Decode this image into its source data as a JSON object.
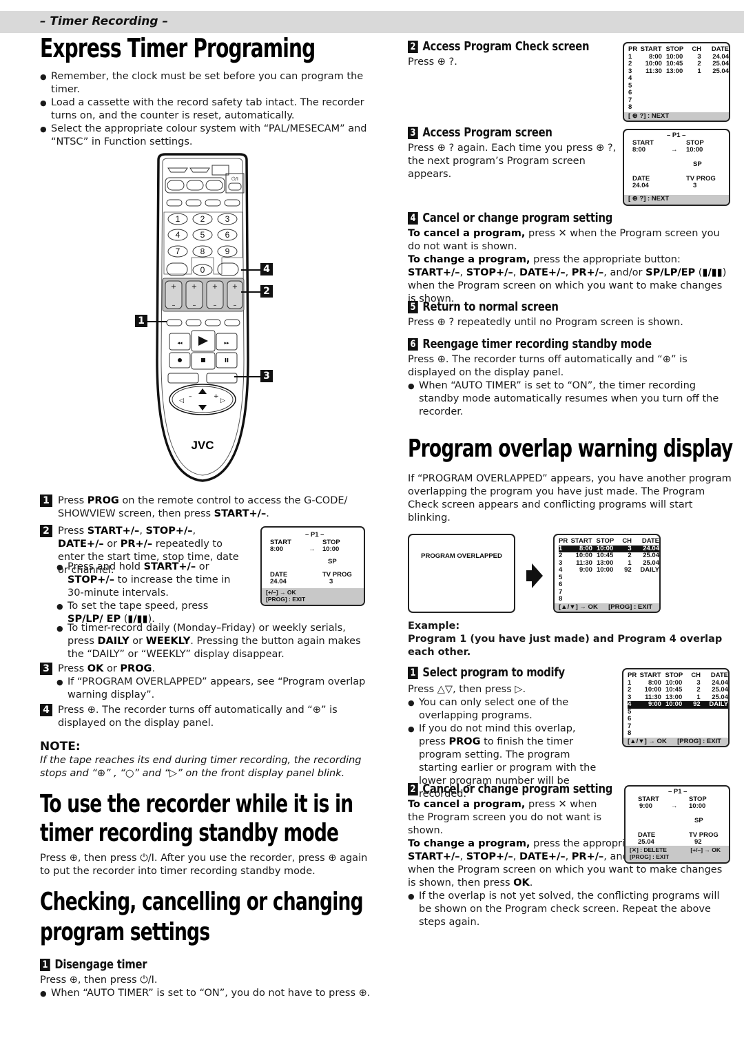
{
  "header": {
    "section_tag": "– Timer Recording –"
  },
  "express": {
    "title": "Express Timer Programing",
    "bullets": [
      "Remember, the clock must be set before you can program the timer.",
      "Load a cassette with the record safety tab intact. The recorder turns on, and the counter is reset, automatically.",
      "Select the appropriate colour system with “PAL/MESECAM” and “NTSC” in Function settings."
    ],
    "remote": {
      "brand": "JVC",
      "keys": [
        "1",
        "2",
        "3",
        "4",
        "5",
        "6",
        "7",
        "8",
        "9",
        "0"
      ],
      "callouts": [
        "1",
        "2",
        "3",
        "4"
      ]
    },
    "steps": [
      {
        "num": "1",
        "text_html": "Press <b>PROG</b> on the remote control to access the G-CODE/ SHOWVIEW screen, then press <b>START+/–</b>."
      },
      {
        "num": "2",
        "text_html": "Press <b>START+/–</b>, <b>STOP+/–</b>, <b>DATE+/–</b> or <b>PR+/–</b> repeatedly to enter the start time, stop time, date or channel."
      },
      {
        "num": "3",
        "text_html": "Press <b>OK</b> or <b>PROG</b>."
      },
      {
        "num": "4",
        "text_html": "Press ⊕. The recorder turns off automatically and “⊕” is displayed on the display panel."
      }
    ],
    "step2_bullets": [
      "Press and hold <b>START+/–</b> or <b>STOP+/–</b> to increase the time in 30-minute intervals.",
      "To set the tape speed, press <b>SP/LP/ EP</b> (<b>▮/▮▮</b>).",
      "To timer-record daily (Monday–Friday) or weekly serials, press <b>DAILY</b> or <b>WEEKLY</b>. Pressing the button again makes the “DAILY” or “WEEKLY” display disappear."
    ],
    "step3_bullets": [
      "If “PROGRAM OVERLAPPED” appears, see “Program overlap warning display”."
    ],
    "osd_p1": {
      "title": "– P1 –",
      "start_label": "START",
      "start": "8:00",
      "arrow": "→",
      "stop_label": "STOP",
      "stop": "10:00",
      "speed": "SP",
      "date_label": "DATE",
      "date": "24.04",
      "tvprog_label": "TV PROG",
      "tvprog": "3",
      "foot1": "[+/–] → OK",
      "foot2": "[PROG] : EXIT"
    }
  },
  "note": {
    "title": "NOTE:",
    "text": "If the tape reaches its end during timer recording, the recording stops and “⊕” , “○” and “▷” on the front display panel blink."
  },
  "standby": {
    "title_l1": "To use the recorder while it is in",
    "title_l2": "timer recording standby mode",
    "text": "Press ⊕, then press ⏻/I. After you use the recorder, press ⊕ again to put the recorder into timer recording standby mode."
  },
  "checking": {
    "title_l1": "Checking, cancelling or changing",
    "title_l2": "program settings",
    "steps": [
      {
        "num": "1",
        "title": "Disengage timer",
        "text": "Press ⊕, then press ⏻/I.",
        "bullet": "When “AUTO TIMER” is set to “ON”, you do not have to press ⊕."
      },
      {
        "num": "2",
        "title": "Access Program Check screen",
        "text": "Press ⊕ ?."
      },
      {
        "num": "3",
        "title": "Access Program screen",
        "text": "Press ⊕ ? again. Each time you press ⊕ ?, the next program’s Program screen appears."
      },
      {
        "num": "4",
        "title": "Cancel or change program setting",
        "cancel_html": "<b>To cancel a program,</b> press ✕ when the Program screen you do not want is shown.",
        "change_html": "<b>To change a program,</b> press the appropriate button: <b>START+/–</b>, <b>STOP+/–</b>, <b>DATE+/–</b>, <b>PR+/–</b>, and/or <b>SP/LP/EP</b> (<b>▮/▮▮</b>) when the Program screen on which you want to make changes is shown."
      },
      {
        "num": "5",
        "title": "Return to normal screen",
        "text": "Press ⊕ ? repeatedly until no Program screen is shown."
      },
      {
        "num": "6",
        "title": "Reengage timer recording standby mode",
        "text": "Press ⊕. The recorder turns off automatically and “⊕” is displayed on the display panel.",
        "bullet": "When “AUTO TIMER” is set to “ON”, the timer recording standby mode automatically resumes when you turn off the recorder."
      }
    ],
    "osd_check": {
      "headers": [
        "PR",
        "START",
        "STOP",
        "CH",
        "DATE"
      ],
      "rows": [
        [
          "1",
          "8:00",
          "10:00",
          "3",
          "24.04"
        ],
        [
          "2",
          "10:00",
          "10:45",
          "2",
          "25.04"
        ],
        [
          "3",
          "11:30",
          "13:00",
          "1",
          "25.04"
        ],
        [
          "4",
          "",
          "",
          "",
          ""
        ],
        [
          "5",
          "",
          "",
          "",
          ""
        ],
        [
          "6",
          "",
          "",
          "",
          ""
        ],
        [
          "7",
          "",
          "",
          "",
          ""
        ],
        [
          "8",
          "",
          "",
          "",
          ""
        ]
      ],
      "foot": "[ ⊕ ?] : NEXT"
    },
    "osd_p1": {
      "title": "– P1 –",
      "start_label": "START",
      "start": "8:00",
      "arrow": "→",
      "stop_label": "STOP",
      "stop": "10:00",
      "speed": "SP",
      "date_label": "DATE",
      "date": "24.04",
      "tvprog_label": "TV PROG",
      "tvprog": "3",
      "foot": "[ ⊕ ?] : NEXT"
    }
  },
  "overlap": {
    "title": "Program overlap warning display",
    "intro": "If “PROGRAM OVERLAPPED” appears, you have another program overlapping the program you have just made. The Program Check screen appears and conflicting programs will start blinking.",
    "warning_screen": "PROGRAM OVERLAPPED",
    "osd_check": {
      "headers": [
        "PR",
        "START",
        "STOP",
        "CH",
        "DATE"
      ],
      "rows": [
        [
          "1",
          "8:00",
          "10:00",
          "3",
          "24.04"
        ],
        [
          "2",
          "10:00",
          "10:45",
          "2",
          "25.04"
        ],
        [
          "3",
          "11:30",
          "13:00",
          "1",
          "25.04"
        ],
        [
          "4",
          "9:00",
          "10:00",
          "92",
          "DAILY"
        ],
        [
          "5",
          "",
          "",
          "",
          ""
        ],
        [
          "6",
          "",
          "",
          "",
          ""
        ],
        [
          "7",
          "",
          "",
          "",
          ""
        ],
        [
          "8",
          "",
          "",
          "",
          ""
        ]
      ],
      "foot_left": "[▲/▼] → OK",
      "foot_right": "[PROG] : EXIT"
    },
    "example_label": "Example:",
    "example_text": "Program 1 (you have just made) and Program 4 overlap each other.",
    "steps": [
      {
        "num": "1",
        "title": "Select program to modify",
        "text": "Press △▽, then press ▷.",
        "bullets": [
          "You can only select one of the overlapping programs.",
          "If you do not mind this overlap, press <b>PROG</b> to finish the timer program setting. The program starting earlier or program with the lower program number will be recorded."
        ]
      },
      {
        "num": "2",
        "title": "Cancel or change program setting",
        "cancel_html": "<b>To cancel a program,</b> press ✕ when the Program screen you do not want is shown.",
        "change_html": "<b>To change a program,</b> press the appropriate button: <b>START+/–</b>, <b>STOP+/–</b>, <b>DATE+/–</b>, <b>PR+/–</b>, and/or <b>SP/LP/EP</b> (<b>▮/▮▮</b>) when the Program screen on which you want to make changes is shown, then press <b>OK</b>.",
        "bullet": "If the overlap is not yet solved, the conflicting programs will be shown on the Program check screen. Repeat the above steps again."
      }
    ],
    "osd_p1": {
      "title": "– P1 –",
      "start_label": "START",
      "start": "9:00",
      "arrow": "→",
      "stop_label": "STOP",
      "stop": "10:00",
      "speed": "SP",
      "date_label": "DATE",
      "date": "25.04",
      "tvprog_label": "TV PROG",
      "tvprog": "92",
      "foot1": "[✕] : DELETE",
      "foot1r": "[+/–] → OK",
      "foot2": "[PROG] : EXIT"
    }
  }
}
